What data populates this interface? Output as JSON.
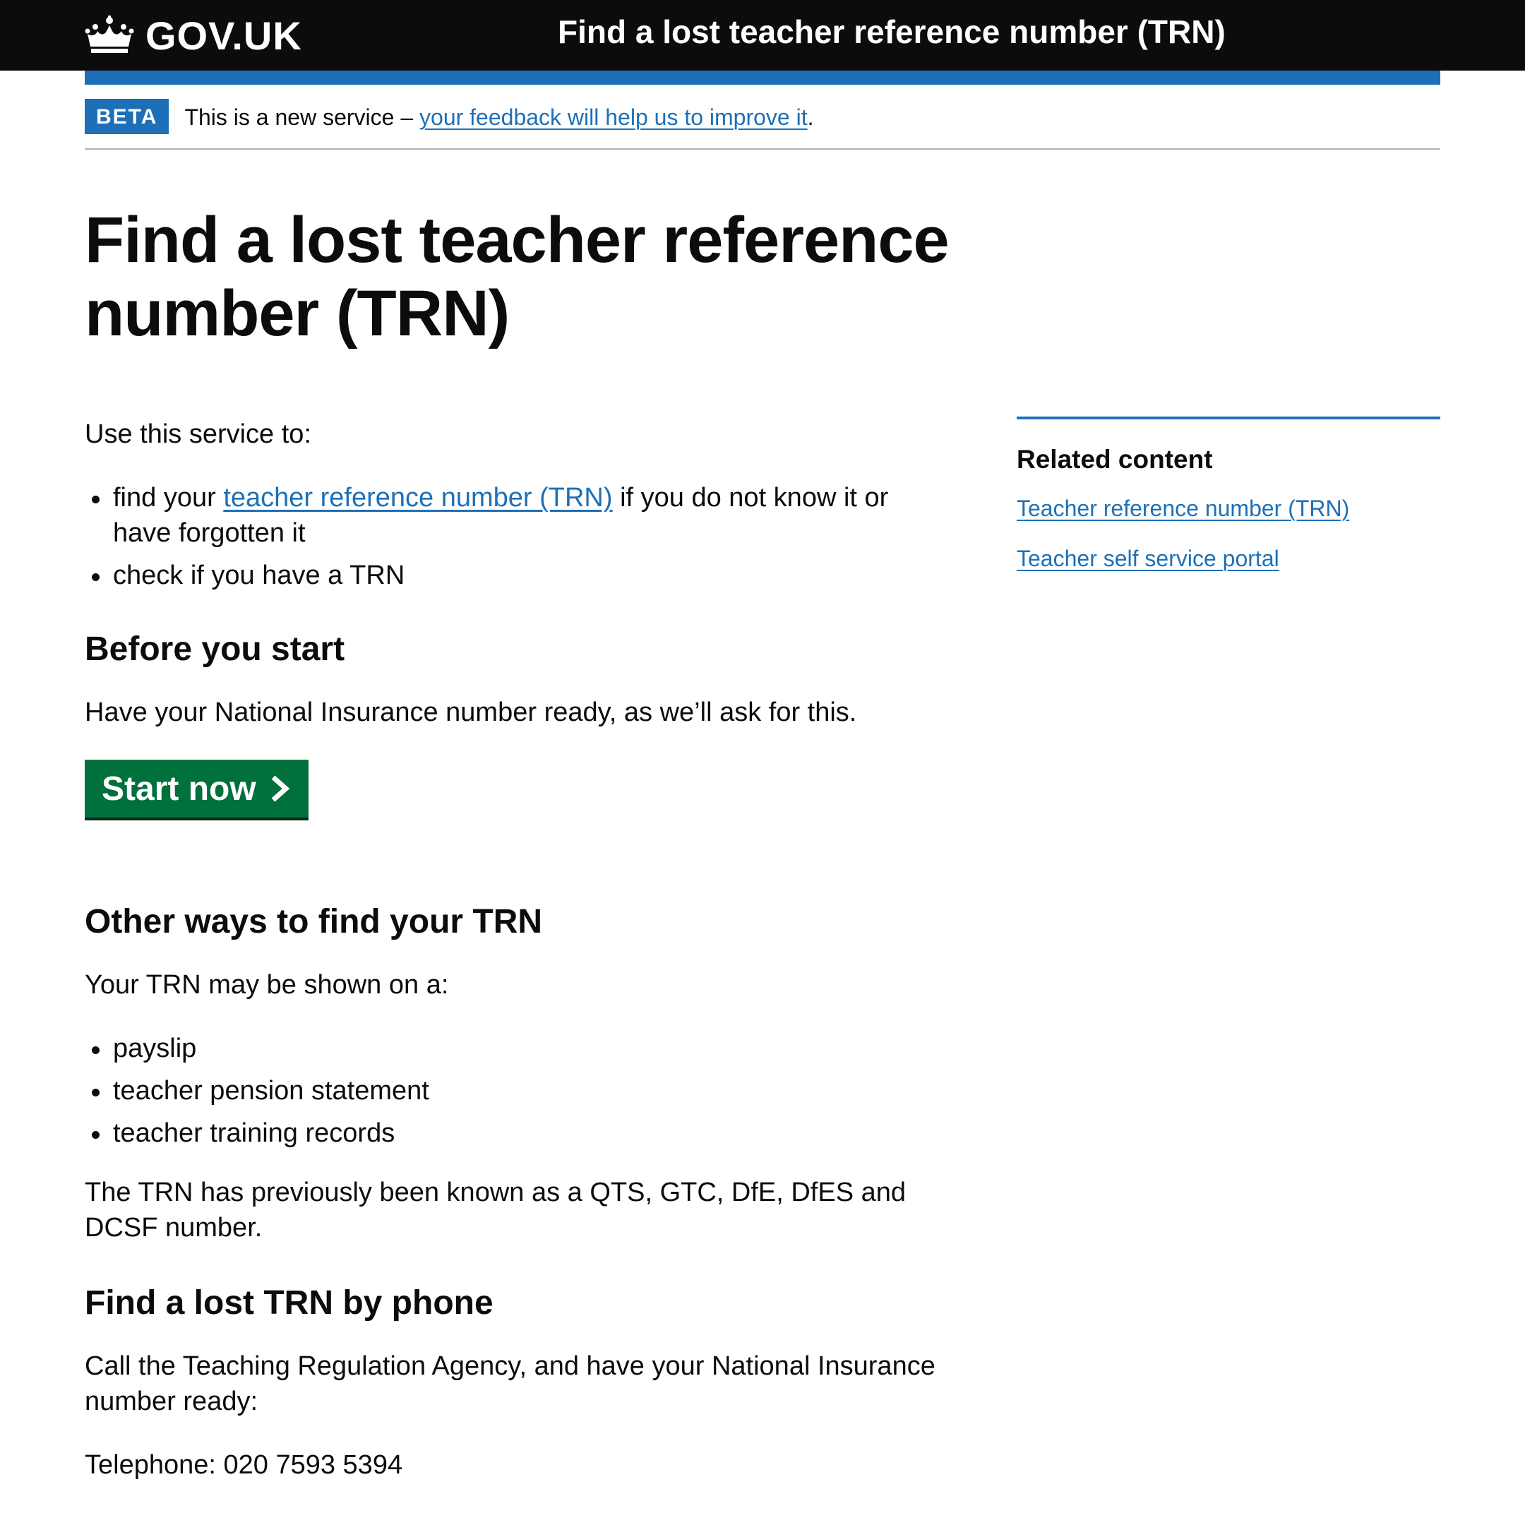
{
  "header": {
    "logo_text": "GOV.UK",
    "service_name": "Find a lost teacher reference number (TRN)"
  },
  "phase_banner": {
    "tag": "BETA",
    "text": "This is a new service – ",
    "link": "your feedback will help us to improve it",
    "suffix": "."
  },
  "page": {
    "title": "Find a lost teacher reference number (TRN)",
    "intro": "Use this service to:",
    "uses": {
      "item1_prefix": "find your ",
      "item1_link": "teacher reference number (TRN)",
      "item1_suffix": " if you do not know it or have forgotten it",
      "item2": "check if you have a TRN"
    },
    "before_heading": "Before you start",
    "before_text": "Have your National Insurance number ready, as we’ll ask for this.",
    "start_button": "Start now",
    "other_heading": "Other ways to find your TRN",
    "other_intro": "Your TRN may be shown on a:",
    "other_items": [
      "payslip",
      "teacher pension statement",
      "teacher training records"
    ],
    "previously_known": "The TRN has previously been known as a QTS, GTC, DfE, DfES and DCSF number.",
    "phone_heading": "Find a lost TRN by phone",
    "phone_text": "Call the Teaching Regulation Agency, and have your National Insurance number ready:",
    "telephone": "Telephone: 020 7593 5394"
  },
  "sidebar": {
    "heading": "Related content",
    "links": [
      "Teacher reference number (TRN)",
      "Teacher self service portal"
    ]
  },
  "colors": {
    "header_bg": "#0b0c0c",
    "accent_blue": "#1d70b8",
    "button_green": "#00703c",
    "text": "#0b0c0c"
  },
  "icons": {
    "logo": "crown-icon",
    "button": "chevron-right-icon"
  }
}
